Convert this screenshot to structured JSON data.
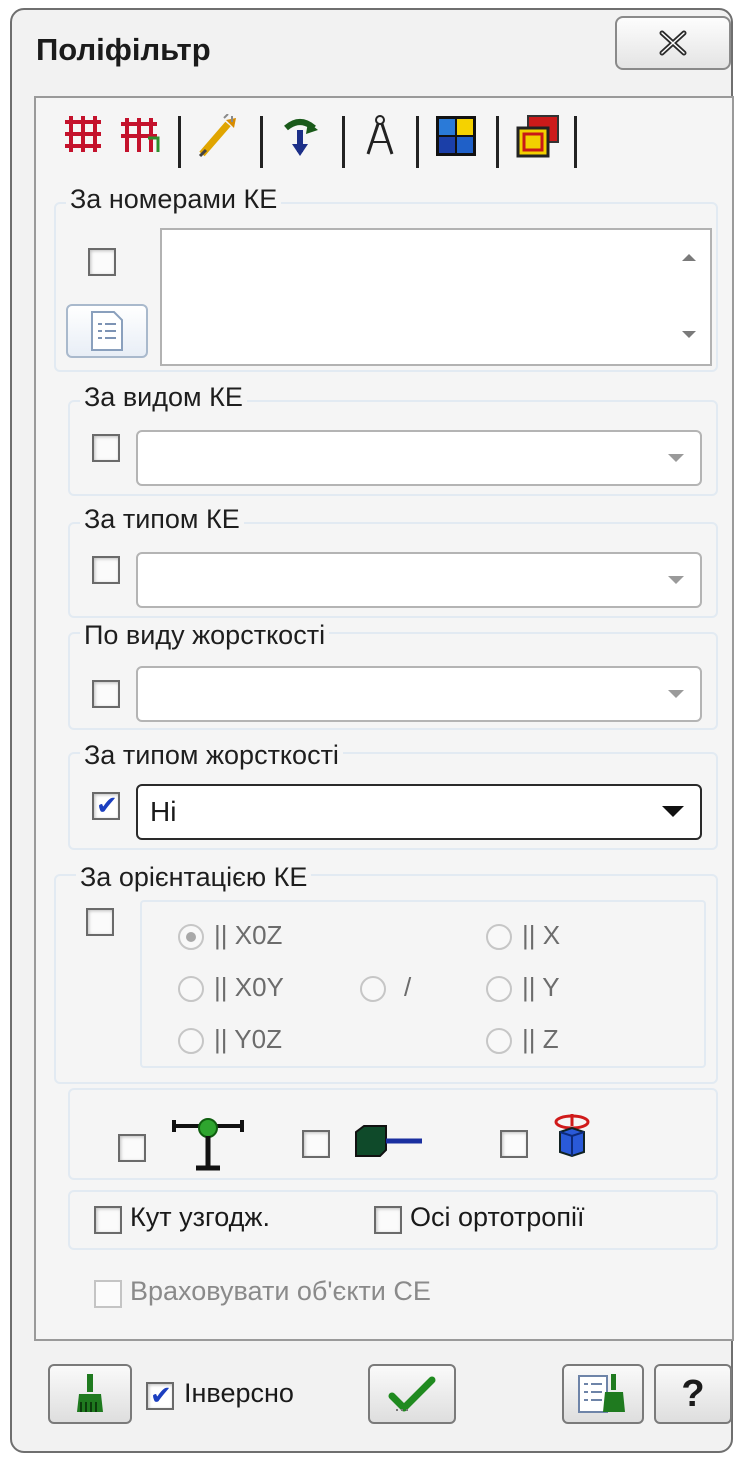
{
  "window": {
    "title": "Поліфільтр"
  },
  "groups": {
    "by_numbers": {
      "label": "За номерами КЕ",
      "checked": false
    },
    "by_kind": {
      "label": "За видом КЕ",
      "checked": false,
      "value": ""
    },
    "by_type": {
      "label": "За типом КЕ",
      "checked": false,
      "value": ""
    },
    "by_stiffness_kind": {
      "label": "По виду жорсткості",
      "checked": false,
      "value": ""
    },
    "by_stiffness_type": {
      "label": "За типом жорсткості",
      "checked": true,
      "value": "Ні"
    },
    "by_orientation": {
      "label": "За орієнтацією КЕ",
      "checked": false,
      "options": {
        "xoz": "|| X0Z",
        "xoy": "|| X0Y",
        "yoz": "|| Y0Z",
        "slash": "/",
        "x": "|| X",
        "y": "|| Y",
        "z": "|| Z"
      },
      "selected": "xoz"
    }
  },
  "options": {
    "angle": "Кут узгодж.",
    "ortho": "Осі ортотропії",
    "se_objects": "Враховувати об'єкти СЕ"
  },
  "footer": {
    "inverse": "Інверсно",
    "inverse_checked": true,
    "help": "?"
  }
}
